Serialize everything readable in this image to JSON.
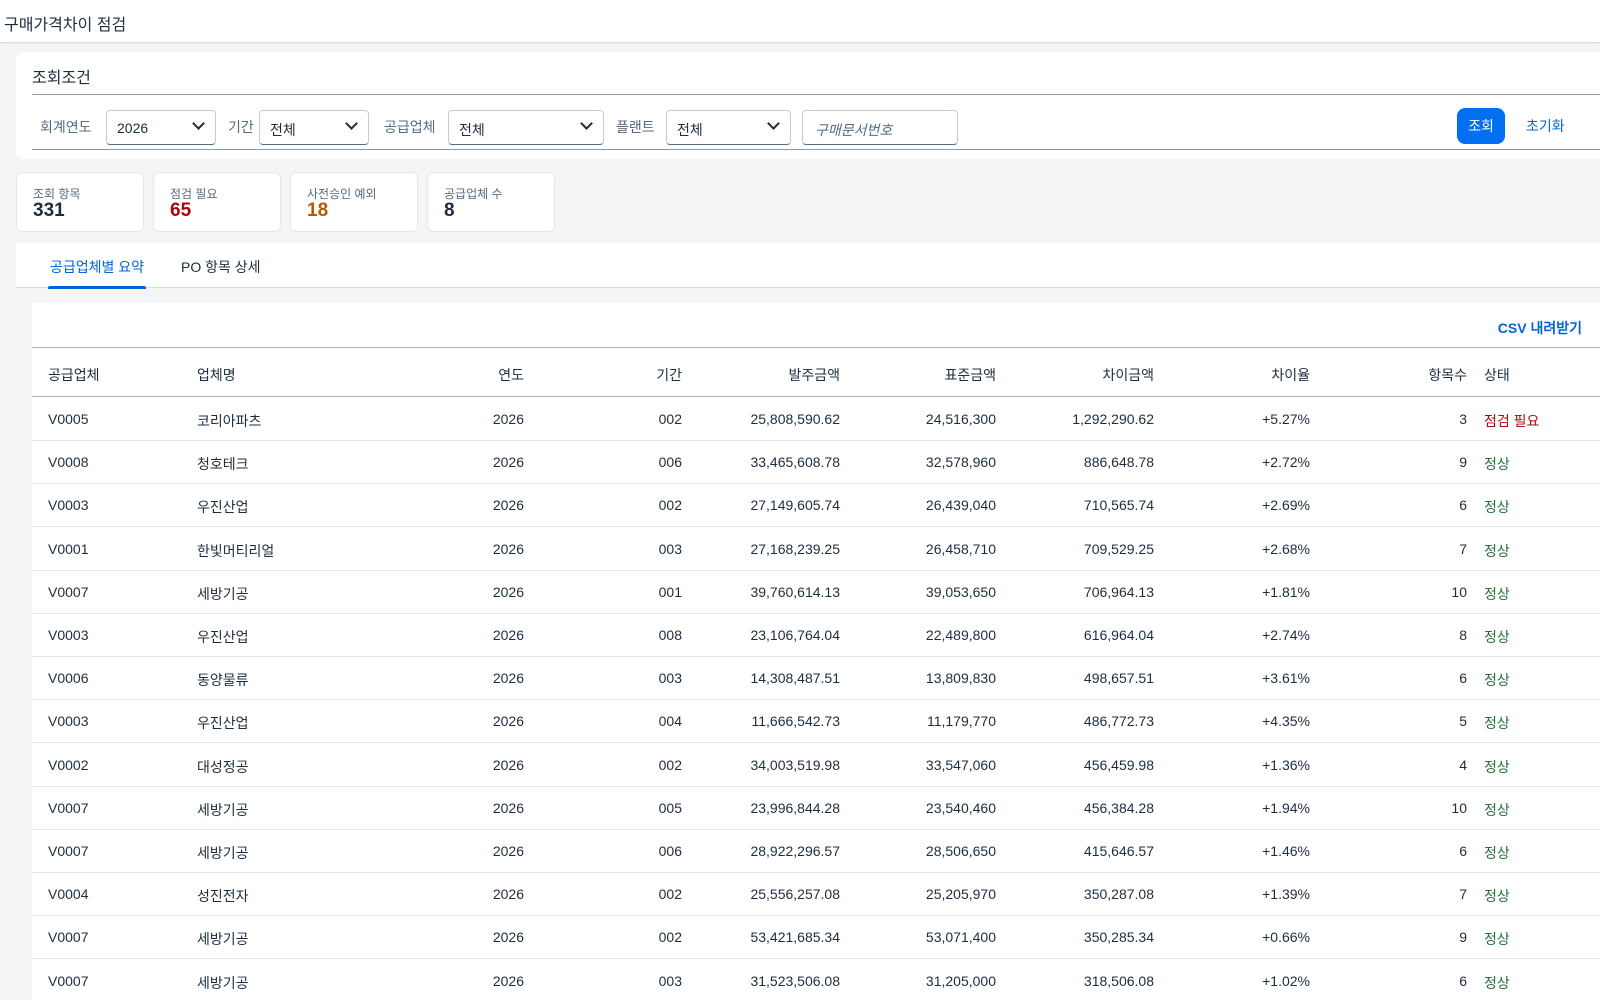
{
  "app": {
    "title": "구매가격차이 점검"
  },
  "filters": {
    "panel_title": "조회조건",
    "fiscal_year": {
      "label": "회계연도",
      "value": "2026"
    },
    "period": {
      "label": "기간",
      "value": "전체"
    },
    "supplier": {
      "label": "공급업체",
      "value": "전체"
    },
    "plant": {
      "label": "플랜트",
      "value": "전체"
    },
    "po_number": {
      "placeholder": "구매문서번호"
    },
    "search_label": "조회",
    "reset_label": "초기화"
  },
  "kpis": [
    {
      "label": "조회 항목",
      "value": "331",
      "color": "#1d2d3e"
    },
    {
      "label": "점검 필요",
      "value": "65",
      "color": "#aa0808"
    },
    {
      "label": "사전승인 예외",
      "value": "18",
      "color": "#b65a00"
    },
    {
      "label": "공급업체 수",
      "value": "8",
      "color": "#1d2d3e"
    }
  ],
  "tabs": [
    {
      "label": "공급업체별 요약",
      "active": true
    },
    {
      "label": "PO 항목 상세",
      "active": false
    }
  ],
  "table": {
    "csv_label": "CSV 내려받기",
    "columns": [
      "공급업체",
      "업체명",
      "연도",
      "기간",
      "발주금액",
      "표준금액",
      "차이금액",
      "차이율",
      "항목수",
      "상태"
    ],
    "rows": [
      [
        "V0005",
        "코리아파츠",
        "2026",
        "002",
        "25,808,590.62",
        "24,516,300",
        "1,292,290.62",
        "+5.27%",
        "3",
        "점검 필요"
      ],
      [
        "V0008",
        "청호테크",
        "2026",
        "006",
        "33,465,608.78",
        "32,578,960",
        "886,648.78",
        "+2.72%",
        "9",
        "정상"
      ],
      [
        "V0003",
        "우진산업",
        "2026",
        "002",
        "27,149,605.74",
        "26,439,040",
        "710,565.74",
        "+2.69%",
        "6",
        "정상"
      ],
      [
        "V0001",
        "한빛머티리얼",
        "2026",
        "003",
        "27,168,239.25",
        "26,458,710",
        "709,529.25",
        "+2.68%",
        "7",
        "정상"
      ],
      [
        "V0007",
        "세방기공",
        "2026",
        "001",
        "39,760,614.13",
        "39,053,650",
        "706,964.13",
        "+1.81%",
        "10",
        "정상"
      ],
      [
        "V0003",
        "우진산업",
        "2026",
        "008",
        "23,106,764.04",
        "22,489,800",
        "616,964.04",
        "+2.74%",
        "8",
        "정상"
      ],
      [
        "V0006",
        "동양물류",
        "2026",
        "003",
        "14,308,487.51",
        "13,809,830",
        "498,657.51",
        "+3.61%",
        "6",
        "정상"
      ],
      [
        "V0003",
        "우진산업",
        "2026",
        "004",
        "11,666,542.73",
        "11,179,770",
        "486,772.73",
        "+4.35%",
        "5",
        "정상"
      ],
      [
        "V0002",
        "대성정공",
        "2026",
        "002",
        "34,003,519.98",
        "33,547,060",
        "456,459.98",
        "+1.36%",
        "4",
        "정상"
      ],
      [
        "V0007",
        "세방기공",
        "2026",
        "005",
        "23,996,844.28",
        "23,540,460",
        "456,384.28",
        "+1.94%",
        "10",
        "정상"
      ],
      [
        "V0007",
        "세방기공",
        "2026",
        "006",
        "28,922,296.57",
        "28,506,650",
        "415,646.57",
        "+1.46%",
        "6",
        "정상"
      ],
      [
        "V0004",
        "성진전자",
        "2026",
        "002",
        "25,556,257.08",
        "25,205,970",
        "350,287.08",
        "+1.39%",
        "7",
        "정상"
      ],
      [
        "V0007",
        "세방기공",
        "2026",
        "002",
        "53,421,685.34",
        "53,071,400",
        "350,285.34",
        "+0.66%",
        "9",
        "정상"
      ],
      [
        "V0007",
        "세방기공",
        "2026",
        "003",
        "31,523,506.08",
        "31,205,000",
        "318,506.08",
        "+1.02%",
        "6",
        "정상"
      ]
    ]
  }
}
